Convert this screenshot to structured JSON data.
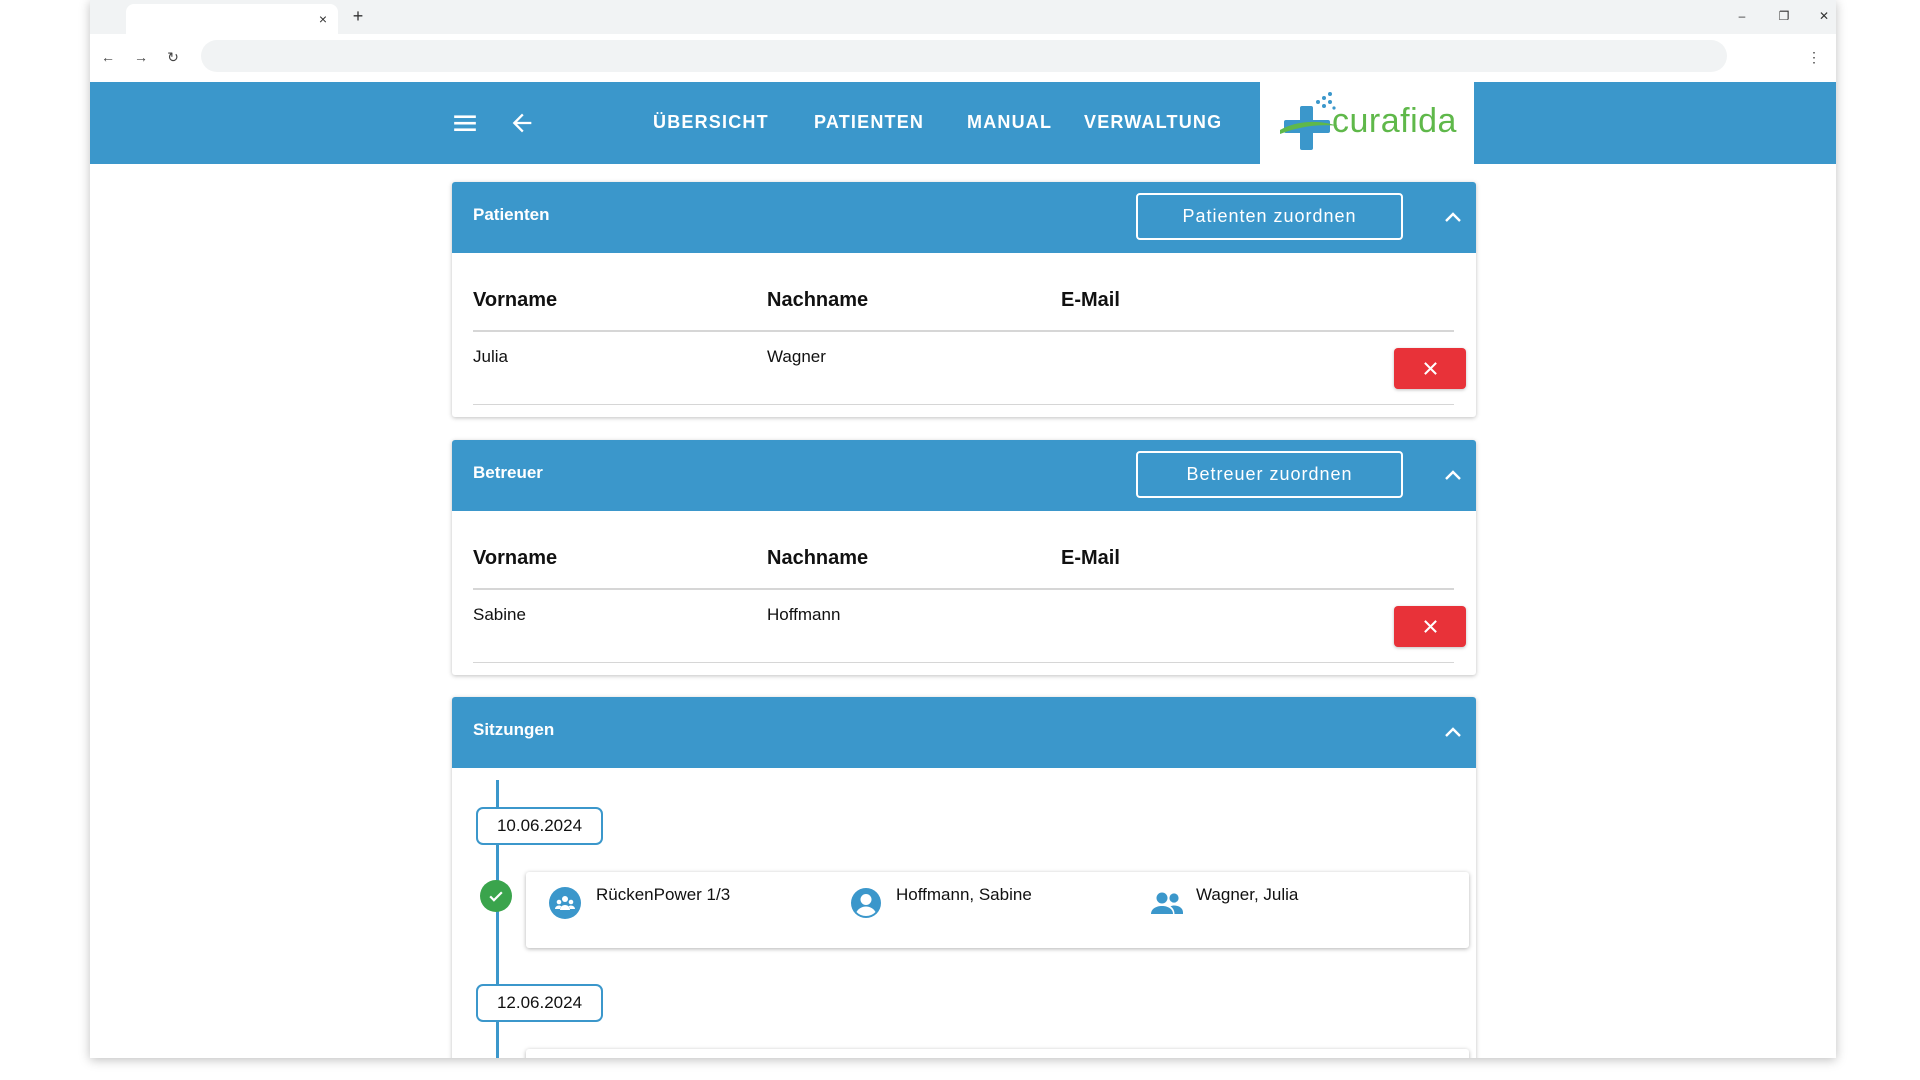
{
  "browser": {
    "tab_close": "×",
    "new_tab": "+",
    "minimize": "–",
    "restore": "❐",
    "close": "✕",
    "back": "←",
    "forward": "→",
    "reload": "↻",
    "menu": "⋮"
  },
  "header": {
    "nav": [
      "ÜBERSICHT",
      "PATIENTEN",
      "MANUAL",
      "VERWALTUNG"
    ],
    "logo_text": "curafida",
    "colors": {
      "primary": "#3b97cb",
      "logo_green": "#5fb84a",
      "danger": "#e83239",
      "success": "#3aa44c"
    }
  },
  "patients": {
    "title": "Patienten",
    "assign_label": "Patienten zuordnen",
    "columns": [
      "Vorname",
      "Nachname",
      "E-Mail"
    ],
    "rows": [
      {
        "first": "Julia",
        "last": "Wagner",
        "email": ""
      }
    ]
  },
  "carers": {
    "title": "Betreuer",
    "assign_label": "Betreuer zuordnen",
    "columns": [
      "Vorname",
      "Nachname",
      "E-Mail"
    ],
    "rows": [
      {
        "first": "Sabine",
        "last": "Hoffmann",
        "email": ""
      }
    ]
  },
  "sessions": {
    "title": "Sitzungen",
    "entries": [
      {
        "date": "10.06.2024",
        "status": "done",
        "course": "RückenPower 1/3",
        "therapist": "Hoffmann, Sabine",
        "participant": "Wagner, Julia"
      },
      {
        "date": "12.06.2024"
      }
    ]
  }
}
